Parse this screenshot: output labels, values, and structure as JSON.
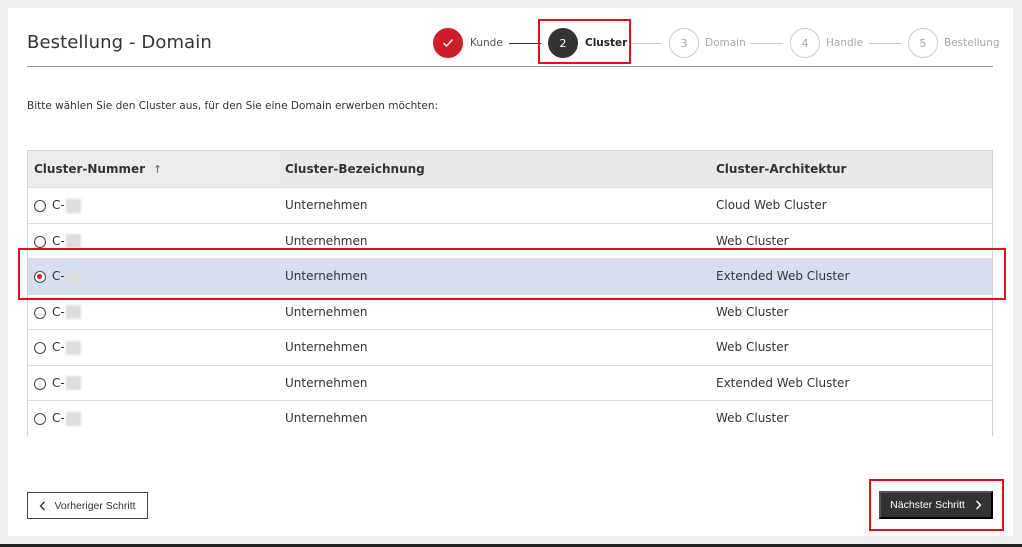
{
  "page": {
    "title": "Bestellung - Domain",
    "instruction": "Bitte wählen Sie den Cluster aus, für den Sie eine Domain erwerben möchten:"
  },
  "stepper": {
    "steps": [
      {
        "number": "",
        "label": "Kunde",
        "state": "done"
      },
      {
        "number": "2",
        "label": "Cluster",
        "state": "active"
      },
      {
        "number": "3",
        "label": "Domain",
        "state": "pending"
      },
      {
        "number": "4",
        "label": "Handle",
        "state": "pending"
      },
      {
        "number": "5",
        "label": "Bestellung",
        "state": "pending"
      }
    ]
  },
  "table": {
    "columns": [
      "Cluster-Nummer",
      "Cluster-Bezeichnung",
      "Cluster-Architektur"
    ],
    "sort_icon": "↑",
    "rows": [
      {
        "id": "C-",
        "name": "Unternehmen",
        "arch": "Cloud Web Cluster",
        "selected": false
      },
      {
        "id": "C-",
        "name": "Unternehmen",
        "arch": "Web Cluster",
        "selected": false
      },
      {
        "id": "C-",
        "name": "Unternehmen",
        "arch": "Extended Web Cluster",
        "selected": true
      },
      {
        "id": "C-",
        "name": "Unternehmen",
        "arch": "Web Cluster",
        "selected": false
      },
      {
        "id": "C-",
        "name": "Unternehmen",
        "arch": "Web Cluster",
        "selected": false
      },
      {
        "id": "C-",
        "name": "Unternehmen",
        "arch": "Extended Web Cluster",
        "selected": false
      },
      {
        "id": "C-",
        "name": "Unternehmen",
        "arch": "Web Cluster",
        "selected": false
      }
    ]
  },
  "buttons": {
    "prev_label": "Vorheriger Schritt",
    "next_label": "Nächster Schritt"
  },
  "colors": {
    "brand_red": "#cc1f2b",
    "highlight_red": "#e0101e",
    "dark": "#333333",
    "selected_row": "#d7deef"
  },
  "icons": {
    "check": "check-icon",
    "sort": "sort-ascending-icon",
    "prev": "chevron-left-icon",
    "next": "chevron-right-icon"
  }
}
